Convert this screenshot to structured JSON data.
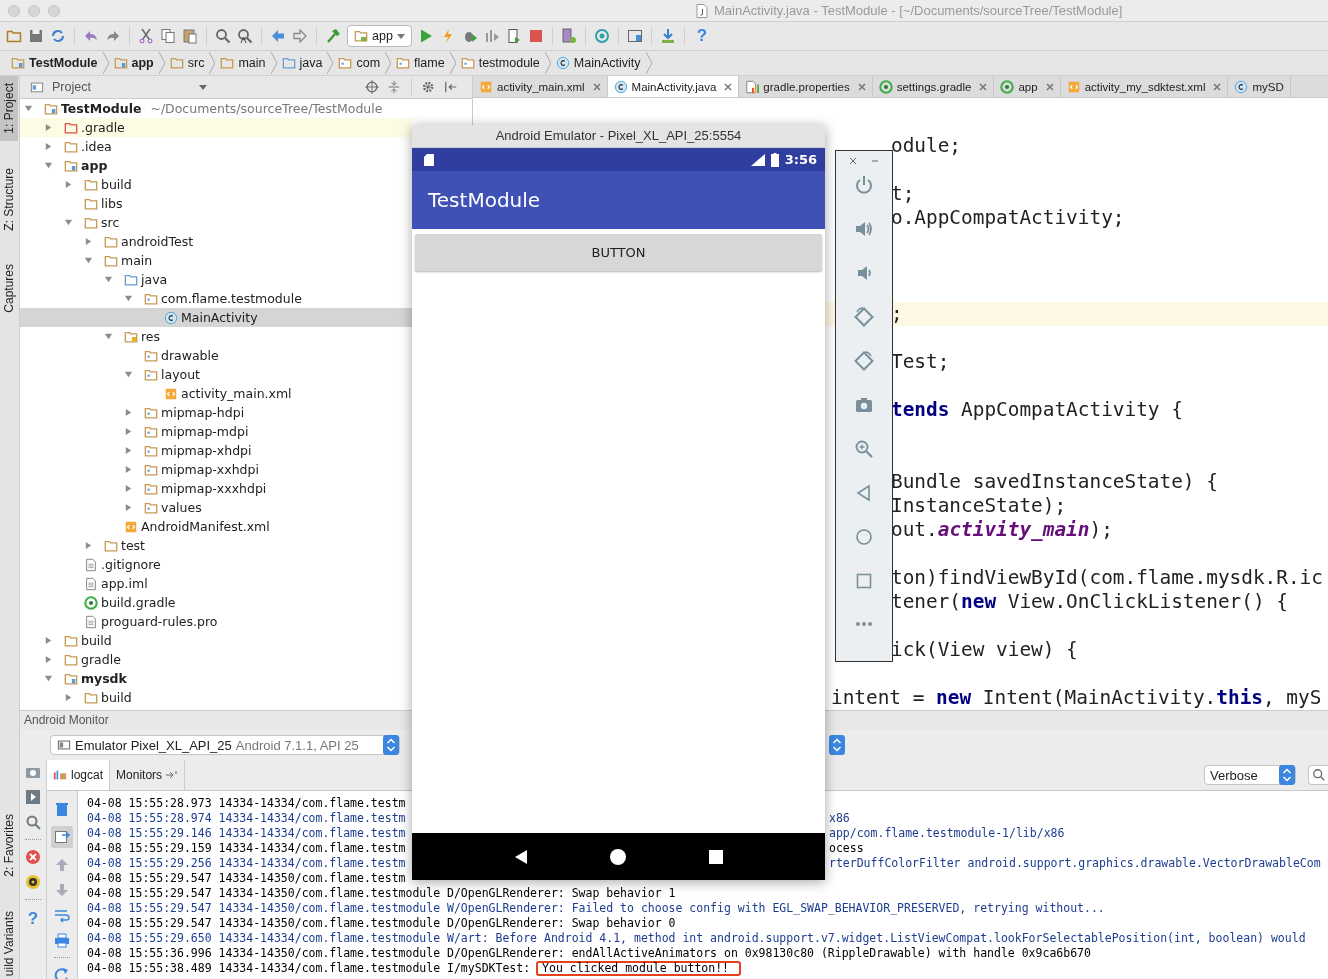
{
  "window": {
    "title": "MainActivity.java - TestModule - [~/Documents/sourceTree/TestModule]"
  },
  "toolbar": {
    "run_config": "app",
    "help": "?"
  },
  "breadcrumb": [
    {
      "label": "TestModule",
      "kind": "module"
    },
    {
      "label": "app",
      "kind": "module"
    },
    {
      "label": "src",
      "kind": "folder"
    },
    {
      "label": "main",
      "kind": "folder"
    },
    {
      "label": "java",
      "kind": "source"
    },
    {
      "label": "com",
      "kind": "package"
    },
    {
      "label": "flame",
      "kind": "package"
    },
    {
      "label": "testmodule",
      "kind": "package"
    },
    {
      "label": "MainActivity",
      "kind": "class"
    }
  ],
  "side_stripe": {
    "top": [
      {
        "label": "1: Project",
        "selected": true
      },
      {
        "label": "Z: Structure",
        "selected": false
      },
      {
        "label": "Captures",
        "selected": false
      }
    ],
    "bottom": [
      {
        "label": "2: Favorites",
        "selected": false
      },
      {
        "label": "uild Variants",
        "selected": false
      }
    ]
  },
  "project": {
    "title": "Project",
    "tree": [
      {
        "label": "TestModule",
        "path": "~/Documents/sourceTree/TestModule",
        "kind": "module",
        "expanded": true,
        "selected": false,
        "children": [
          {
            "label": ".gradle",
            "kind": "excluded",
            "expanded": false,
            "selected": false,
            "highlighted": true
          },
          {
            "label": ".idea",
            "kind": "folder",
            "expanded": false,
            "selected": false
          },
          {
            "label": "app",
            "kind": "module",
            "expanded": true,
            "selected": false,
            "children": [
              {
                "label": "build",
                "kind": "folder",
                "expanded": false,
                "selected": false
              },
              {
                "label": "libs",
                "kind": "folder",
                "selected": false
              },
              {
                "label": "src",
                "kind": "folder",
                "expanded": true,
                "selected": false,
                "children": [
                  {
                    "label": "androidTest",
                    "kind": "folder",
                    "expanded": false,
                    "selected": false
                  },
                  {
                    "label": "main",
                    "kind": "folder",
                    "expanded": true,
                    "selected": false,
                    "children": [
                      {
                        "label": "java",
                        "kind": "source",
                        "expanded": true,
                        "selected": false,
                        "children": [
                          {
                            "label": "com.flame.testmodule",
                            "kind": "package",
                            "expanded": true,
                            "selected": false,
                            "children": [
                              {
                                "label": "MainActivity",
                                "kind": "class",
                                "selected": true
                              }
                            ]
                          }
                        ]
                      },
                      {
                        "label": "res",
                        "kind": "res",
                        "expanded": true,
                        "selected": false,
                        "children": [
                          {
                            "label": "drawable",
                            "kind": "package",
                            "selected": false
                          },
                          {
                            "label": "layout",
                            "kind": "package",
                            "expanded": true,
                            "selected": false,
                            "children": [
                              {
                                "label": "activity_main.xml",
                                "kind": "xml",
                                "selected": false
                              }
                            ]
                          },
                          {
                            "label": "mipmap-hdpi",
                            "kind": "package",
                            "expanded": false,
                            "selected": false
                          },
                          {
                            "label": "mipmap-mdpi",
                            "kind": "package",
                            "expanded": false,
                            "selected": false
                          },
                          {
                            "label": "mipmap-xhdpi",
                            "kind": "package",
                            "expanded": false,
                            "selected": false
                          },
                          {
                            "label": "mipmap-xxhdpi",
                            "kind": "package",
                            "expanded": false,
                            "selected": false
                          },
                          {
                            "label": "mipmap-xxxhdpi",
                            "kind": "package",
                            "expanded": false,
                            "selected": false
                          },
                          {
                            "label": "values",
                            "kind": "package",
                            "expanded": false,
                            "selected": false
                          }
                        ]
                      },
                      {
                        "label": "AndroidManifest.xml",
                        "kind": "manifest",
                        "selected": false
                      }
                    ]
                  },
                  {
                    "label": "test",
                    "kind": "folder",
                    "expanded": false,
                    "selected": false
                  }
                ]
              },
              {
                "label": ".gitignore",
                "kind": "text",
                "selected": false
              },
              {
                "label": "app.iml",
                "kind": "text",
                "selected": false
              },
              {
                "label": "build.gradle",
                "kind": "gradle",
                "selected": false
              },
              {
                "label": "proguard-rules.pro",
                "kind": "text",
                "selected": false
              }
            ]
          },
          {
            "label": "build",
            "kind": "folder",
            "expanded": false,
            "selected": false
          },
          {
            "label": "gradle",
            "kind": "folder",
            "expanded": false,
            "selected": false
          },
          {
            "label": "mysdk",
            "kind": "module",
            "expanded": true,
            "selected": false,
            "children": [
              {
                "label": "build",
                "kind": "folder",
                "expanded": false,
                "selected": false
              }
            ]
          }
        ]
      }
    ]
  },
  "editor": {
    "tabs": [
      {
        "label": "activity_main.xml",
        "kind": "xml",
        "selected": false
      },
      {
        "label": "MainActivity.java",
        "kind": "class",
        "selected": true
      },
      {
        "label": "gradle.properties",
        "kind": "properties",
        "selected": false
      },
      {
        "label": "settings.gradle",
        "kind": "gradle",
        "selected": false
      },
      {
        "label": "app",
        "kind": "gradle",
        "selected": false
      },
      {
        "label": "activity_my_sdktest.xml",
        "kind": "xml",
        "selected": false
      },
      {
        "label": "mySD",
        "kind": "class",
        "selected": false
      }
    ],
    "lines": [
      {
        "kind": "partial",
        "segments": [
          {
            "text": "odule;",
            "kind": "plain"
          }
        ]
      },
      {
        "kind": "blank"
      },
      {
        "kind": "partial",
        "segments": [
          {
            "text": "t;",
            "kind": "plain"
          }
        ]
      },
      {
        "kind": "partial",
        "segments": [
          {
            "text": "o.AppCompatActivity;",
            "kind": "plain"
          }
        ]
      },
      {
        "kind": "blank"
      },
      {
        "kind": "blank"
      },
      {
        "kind": "blank"
      },
      {
        "kind": "partial",
        "highlighted": true,
        "segments": [
          {
            "text": ";",
            "kind": "plain"
          }
        ]
      },
      {
        "kind": "blank"
      },
      {
        "kind": "partial",
        "segments": [
          {
            "text": "Test;",
            "kind": "plain"
          }
        ]
      },
      {
        "kind": "blank"
      },
      {
        "kind": "partial",
        "segments": [
          {
            "text": "tends",
            "kind": "keyword"
          },
          {
            "text": " AppCompatActivity {",
            "kind": "plain"
          }
        ]
      },
      {
        "kind": "blank"
      },
      {
        "kind": "blank"
      },
      {
        "kind": "partial",
        "segments": [
          {
            "text": "Bundle savedInstanceState) {",
            "kind": "plain"
          }
        ]
      },
      {
        "kind": "partial",
        "segments": [
          {
            "text": "InstanceState);",
            "kind": "plain"
          }
        ]
      },
      {
        "kind": "partial",
        "segments": [
          {
            "text": "out.",
            "kind": "plain"
          },
          {
            "text": "activity_main",
            "kind": "field"
          },
          {
            "text": ");",
            "kind": "plain"
          }
        ]
      },
      {
        "kind": "blank"
      },
      {
        "kind": "partial",
        "segments": [
          {
            "text": "ton)findViewById(com.flame.mysdk.R.ic",
            "kind": "plain"
          }
        ]
      },
      {
        "kind": "partial",
        "segments": [
          {
            "text": "tener(",
            "kind": "plain"
          },
          {
            "text": "new",
            "kind": "keyword"
          },
          {
            "text": " View.OnClickListener() {",
            "kind": "plain"
          }
        ]
      },
      {
        "kind": "blank"
      },
      {
        "kind": "partial",
        "segments": [
          {
            "text": "ick(View view) {",
            "kind": "plain"
          }
        ]
      },
      {
        "kind": "blank"
      },
      {
        "kind": "full",
        "segments": [
          {
            "text": "intent = ",
            "kind": "plain"
          },
          {
            "text": "new",
            "kind": "keyword"
          },
          {
            "text": " Intent(MainActivity.",
            "kind": "plain"
          },
          {
            "text": "this",
            "kind": "keyword"
          },
          {
            "text": ", myS",
            "kind": "plain"
          }
        ]
      }
    ]
  },
  "emulator": {
    "title": "Android Emulator - Pixel_XL_API_25:5554",
    "time": "3:56",
    "app_title": "TestModule",
    "button": "BUTTON"
  },
  "monitor": {
    "title": "Android Monitor",
    "device": {
      "name": "Emulator Pixel_XL_API_25",
      "detail": "Android 7.1.1, API 25"
    },
    "tabs": [
      {
        "label": "logcat",
        "selected": true
      },
      {
        "label": "Monitors",
        "selected": false
      }
    ],
    "log_level": "Verbose",
    "help": "?",
    "log": [
      {
        "color": "#000000",
        "left": "04-08 15:55:28.973 14334-14334/com.flame.testm"
      },
      {
        "color": "#1c3d8f",
        "left": "04-08 15:55:28.974 14334-14334/com.flame.testm",
        "right": "x86"
      },
      {
        "color": "#1c3d8f",
        "left": "04-08 15:55:29.146 14334-14334/com.flame.testm",
        "right": "app/com.flame.testmodule-1/lib/x86"
      },
      {
        "color": "#000000",
        "left": "04-08 15:55:29.159 14334-14334/com.flame.testm",
        "right": "ocess"
      },
      {
        "color": "#1c3d8f",
        "left": "04-08 15:55:29.256 14334-14334/com.flame.testm",
        "right": "rterDuffColorFilter android.support.graphics.drawable.VectorDrawableCom"
      },
      {
        "color": "#000000",
        "left": "04-08 15:55:29.547 14334-14350/com.flame.testm"
      },
      {
        "color": "#000000",
        "text": "04-08 15:55:29.547 14334-14350/com.flame.testmodule D/OpenGLRenderer: Swap behavior 1"
      },
      {
        "color": "#1c3d8f",
        "text": "04-08 15:55:29.547 14334-14350/com.flame.testmodule W/OpenGLRenderer: Failed to choose config with EGL_SWAP_BEHAVIOR_PRESERVED, retrying without..."
      },
      {
        "color": "#000000",
        "text": "04-08 15:55:29.547 14334-14350/com.flame.testmodule D/OpenGLRenderer: Swap behavior 0"
      },
      {
        "color": "#1c3d8f",
        "text": "04-08 15:55:29.650 14334-14334/com.flame.testmodule W/art: Before Android 4.1, method int android.support.v7.widget.ListViewCompat.lookForSelectablePosition(int, boolean) would"
      },
      {
        "color": "#000000",
        "text": "04-08 15:55:36.996 14334-14350/com.flame.testmodule D/OpenGLRenderer: endAllActiveAnimators on 0x98130c80 (RippleDrawable) with handle 0x9ca6b670"
      },
      {
        "color": "#000000",
        "text": "04-08 15:55:38.489 14334-14334/com.flame.testmodule I/mySDKTest:",
        "boxed_text": "You clicked module button!!"
      }
    ]
  }
}
